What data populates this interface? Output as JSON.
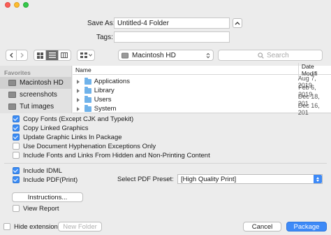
{
  "save_as": {
    "label": "Save As:",
    "value": "Untitled-4 Folder"
  },
  "tags": {
    "label": "Tags:",
    "value": ""
  },
  "toolbar": {
    "location": "Macintosh HD",
    "search_placeholder": "Search",
    "icons": [
      "back-icon",
      "forward-icon",
      "icon-view-icon",
      "list-view-icon",
      "column-view-icon",
      "arrange-icon"
    ]
  },
  "sidebar": {
    "heading": "Favorites",
    "items": [
      {
        "label": "Macintosh HD",
        "selected": true
      },
      {
        "label": "screenshots",
        "selected": false
      },
      {
        "label": "Tut images",
        "selected": false
      }
    ]
  },
  "file_list": {
    "columns": [
      "Name",
      "Date Modifi"
    ],
    "rows": [
      {
        "name": "Applications",
        "date": "Aug 7, 2019"
      },
      {
        "name": "Library",
        "date": "Feb 6, 2019"
      },
      {
        "name": "Users",
        "date": "Dec 18, 201"
      },
      {
        "name": "System",
        "date": "Dec 16, 201"
      }
    ]
  },
  "options": {
    "copy_fonts": {
      "label": "Copy Fonts (Except CJK and Typekit)",
      "checked": true
    },
    "copy_graphics": {
      "label": "Copy Linked Graphics",
      "checked": true
    },
    "update_links": {
      "label": "Update Graphic Links In Package",
      "checked": true
    },
    "hyphenation": {
      "label": "Use Document Hyphenation Exceptions Only",
      "checked": false
    },
    "hidden_content": {
      "label": "Include Fonts and Links From Hidden and Non-Printing Content",
      "checked": false
    },
    "include_idml": {
      "label": "Include IDML",
      "checked": true
    },
    "include_pdf": {
      "label": "Include PDF(Print)",
      "checked": true
    },
    "pdf_preset_label": "Select PDF Preset:",
    "pdf_preset_value": "[High Quality Print]",
    "instructions_button": "Instructions...",
    "view_report": {
      "label": "View Report",
      "checked": false
    }
  },
  "footer": {
    "hide_extension": "Hide extension",
    "new_folder": "New Folder",
    "cancel": "Cancel",
    "package": "Package"
  },
  "colors": {
    "accent": "#3e8af7",
    "folder": "#6fb2ea"
  }
}
